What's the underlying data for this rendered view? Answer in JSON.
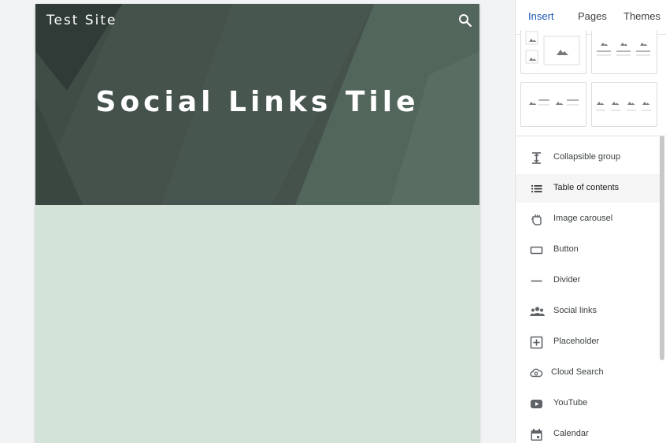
{
  "site": {
    "title": "Test Site",
    "hero_title": "Social Links Tile"
  },
  "colors": {
    "hero_bg": "#3f4d46",
    "body_bg": "#d3e3d7",
    "accent": "#1a56b5"
  },
  "panel": {
    "tabs": [
      {
        "label": "Insert",
        "active": true
      },
      {
        "label": "Pages",
        "active": false
      },
      {
        "label": "Themes",
        "active": false
      }
    ],
    "items": [
      {
        "label": "Collapsible group",
        "icon": "collapsible-group-icon"
      },
      {
        "label": "Table of contents",
        "icon": "table-of-contents-icon"
      },
      {
        "label": "Image carousel",
        "icon": "image-carousel-icon"
      },
      {
        "label": "Button",
        "icon": "button-icon"
      },
      {
        "label": "Divider",
        "icon": "divider-icon"
      },
      {
        "label": "Social links",
        "icon": "social-links-icon"
      },
      {
        "label": "Placeholder",
        "icon": "placeholder-icon"
      },
      {
        "label": "Cloud Search",
        "icon": "cloud-search-icon"
      },
      {
        "label": "YouTube",
        "icon": "youtube-icon"
      },
      {
        "label": "Calendar",
        "icon": "calendar-icon"
      }
    ]
  }
}
